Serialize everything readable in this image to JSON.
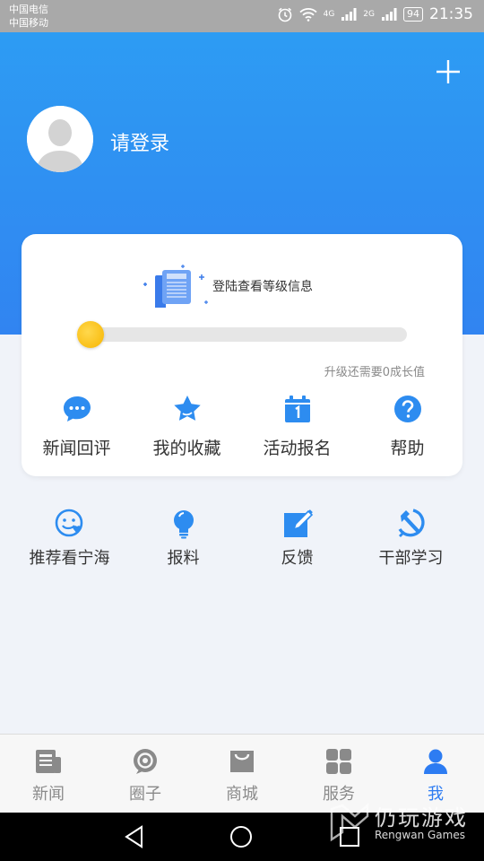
{
  "status": {
    "carrier1": "中国电信",
    "carrier2": "中国移动",
    "network1": "4G",
    "network2": "2G",
    "battery": "94",
    "time": "21:35"
  },
  "profile": {
    "login_text": "请登录"
  },
  "level": {
    "info_text": "登陆查看等级信息",
    "upgrade_text": "升级还需要0成长值",
    "progress": 0
  },
  "card_items": [
    {
      "label": "新闻回评",
      "icon": "chat-bubble-icon"
    },
    {
      "label": "我的收藏",
      "icon": "star-icon"
    },
    {
      "label": "活动报名",
      "icon": "calendar-icon"
    },
    {
      "label": "帮助",
      "icon": "help-icon"
    }
  ],
  "row_items": [
    {
      "label": "推荐看宁海",
      "icon": "smiley-heart-icon"
    },
    {
      "label": "报料",
      "icon": "lightbulb-icon"
    },
    {
      "label": "反馈",
      "icon": "edit-icon"
    },
    {
      "label": "干部学习",
      "icon": "hammer-sickle-icon"
    }
  ],
  "tabs": [
    {
      "label": "新闻",
      "icon": "news-icon",
      "active": false
    },
    {
      "label": "圈子",
      "icon": "circle-icon",
      "active": false
    },
    {
      "label": "商城",
      "icon": "shop-bag-icon",
      "active": false
    },
    {
      "label": "服务",
      "icon": "grid-icon",
      "active": false
    },
    {
      "label": "我",
      "icon": "user-icon",
      "active": true
    }
  ],
  "watermark": {
    "title": "仍玩游戏",
    "subtitle": "Rengwan Games"
  },
  "colors": {
    "primary": "#2d7cf2",
    "header_top": "#2d9cf3",
    "accent_yellow": "#f7b500"
  }
}
